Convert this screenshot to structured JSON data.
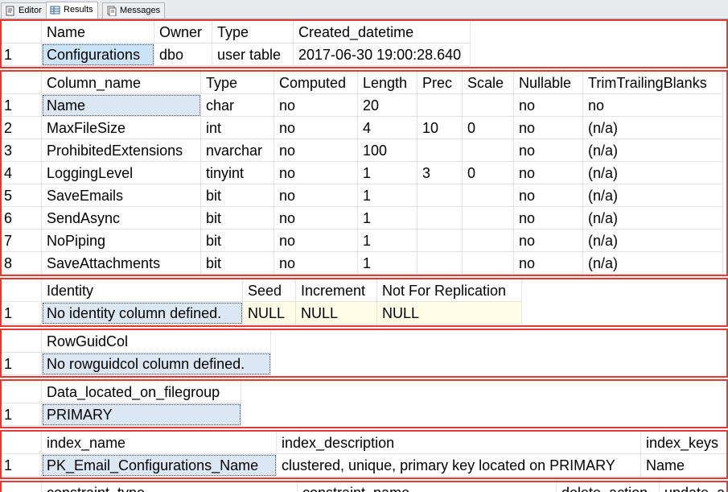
{
  "tabs": [
    {
      "label": "Editor",
      "icon": "editor-icon"
    },
    {
      "label": "Results",
      "icon": "results-grid-icon"
    },
    {
      "label": "Messages",
      "icon": "messages-icon"
    }
  ],
  "grid1": {
    "headers": [
      "Name",
      "Owner",
      "Type",
      "Created_datetime"
    ],
    "rows": [
      {
        "num": "1",
        "cells": [
          "Configurations",
          "dbo",
          "user table",
          "2017-06-30 19:00:28.640"
        ]
      }
    ]
  },
  "grid2": {
    "headers": [
      "Column_name",
      "Type",
      "Computed",
      "Length",
      "Prec",
      "Scale",
      "Nullable",
      "TrimTrailingBlanks"
    ],
    "rows": [
      {
        "num": "1",
        "cells": [
          "Name",
          "char",
          "no",
          "20",
          "",
          "",
          "no",
          "no"
        ]
      },
      {
        "num": "2",
        "cells": [
          "MaxFileSize",
          "int",
          "no",
          "4",
          "10",
          "0",
          "no",
          "(n/a)"
        ]
      },
      {
        "num": "3",
        "cells": [
          "ProhibitedExtensions",
          "nvarchar",
          "no",
          "100",
          "",
          "",
          "no",
          "(n/a)"
        ]
      },
      {
        "num": "4",
        "cells": [
          "LoggingLevel",
          "tinyint",
          "no",
          "1",
          "3",
          "0",
          "no",
          "(n/a)"
        ]
      },
      {
        "num": "5",
        "cells": [
          "SaveEmails",
          "bit",
          "no",
          "1",
          "",
          "",
          "no",
          "(n/a)"
        ]
      },
      {
        "num": "6",
        "cells": [
          "SendAsync",
          "bit",
          "no",
          "1",
          "",
          "",
          "no",
          "(n/a)"
        ]
      },
      {
        "num": "7",
        "cells": [
          "NoPiping",
          "bit",
          "no",
          "1",
          "",
          "",
          "no",
          "(n/a)"
        ]
      },
      {
        "num": "8",
        "cells": [
          "SaveAttachments",
          "bit",
          "no",
          "1",
          "",
          "",
          "no",
          "(n/a)"
        ]
      }
    ]
  },
  "grid3": {
    "headers": [
      "Identity",
      "Seed",
      "Increment",
      "Not For Replication"
    ],
    "rows": [
      {
        "num": "1",
        "cells": [
          "No identity column defined.",
          "NULL",
          "NULL",
          "NULL"
        ]
      }
    ]
  },
  "grid4": {
    "headers": [
      "RowGuidCol"
    ],
    "rows": [
      {
        "num": "1",
        "cells": [
          "No rowguidcol column defined."
        ]
      }
    ]
  },
  "grid5": {
    "headers": [
      "Data_located_on_filegroup"
    ],
    "rows": [
      {
        "num": "1",
        "cells": [
          "PRIMARY"
        ]
      }
    ]
  },
  "grid6": {
    "headers": [
      "index_name",
      "index_description",
      "index_keys"
    ],
    "rows": [
      {
        "num": "1",
        "cells": [
          "PK_Email_Configurations_Name",
          "clustered, unique, primary key located on PRIMARY",
          "Name"
        ]
      }
    ]
  },
  "grid7": {
    "headers": [
      "constraint_type",
      "constraint_name",
      "delete_action",
      "update_a"
    ]
  },
  "colors": {
    "selected_cell": "#cce4f7",
    "null_cell": "#fffde6",
    "grid_border": "#e53935"
  }
}
